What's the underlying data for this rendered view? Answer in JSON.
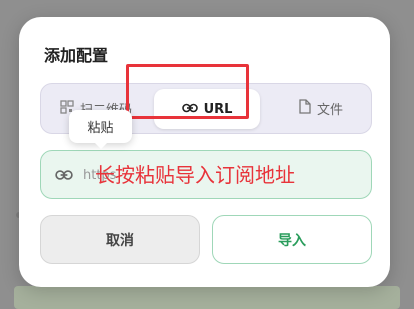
{
  "dialog": {
    "title": "添加配置",
    "tabs": [
      {
        "label": "扫二维码",
        "icon": "qr-code-icon"
      },
      {
        "label": "URL",
        "icon": "link-icon"
      },
      {
        "label": "文件",
        "icon": "file-icon"
      }
    ],
    "url_field": {
      "value": "https",
      "icon": "link-icon"
    },
    "tooltip": "粘贴",
    "annotation": "长按粘贴导入订阅地址",
    "buttons": {
      "cancel": "取消",
      "import": "导入"
    }
  },
  "colors": {
    "accent_green": "#2a9d5c",
    "highlight_red": "#e8333a",
    "segment_bg": "#ecebf5",
    "field_bg": "#eaf6ef"
  }
}
